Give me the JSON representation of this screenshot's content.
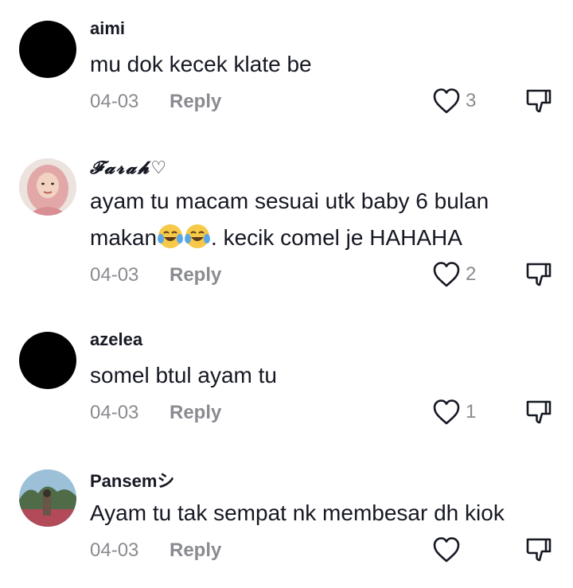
{
  "comments": [
    {
      "username": "aimi",
      "text": "mu dok kecek klate be",
      "date": "04-03",
      "reply_label": "Reply",
      "likes": "3"
    },
    {
      "username": "𝓕𝓪𝓻𝓪𝓱",
      "username_suffix": "♡",
      "text_line1": "ayam tu macam sesuai utk baby 6 bulan",
      "text_line2_pre": "makan",
      "text_line2_post": ". kecik comel je HAHAHA",
      "emoji_name": "face-with-tears-of-joy",
      "date": "04-03",
      "reply_label": "Reply",
      "likes": "2"
    },
    {
      "username": "azelea",
      "text": "somel btul ayam tu",
      "date": "04-03",
      "reply_label": "Reply",
      "likes": "1"
    },
    {
      "username": "Pansemシ",
      "text": "Ayam tu tak sempat nk membesar dh kiok",
      "date": "04-03",
      "reply_label": "Reply",
      "likes": ""
    }
  ],
  "icons": {
    "like": "heart-outline-icon",
    "dislike": "thumbs-down-icon"
  },
  "colors": {
    "text_primary": "#161823",
    "text_secondary": "#8a8b91",
    "icon_stroke": "#161823"
  }
}
